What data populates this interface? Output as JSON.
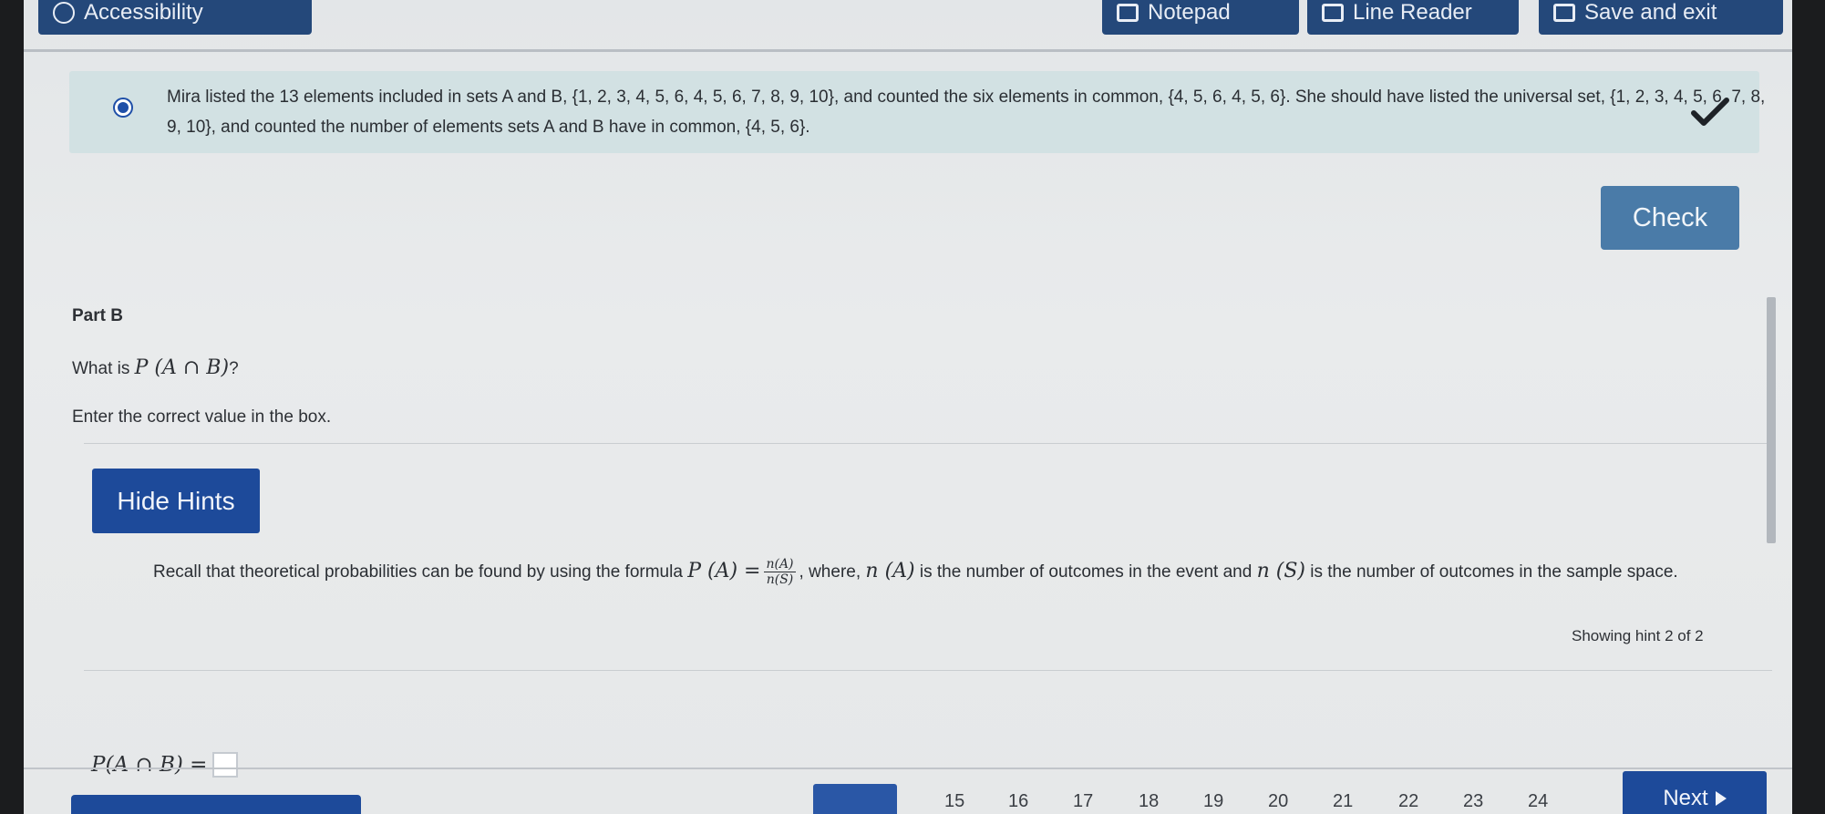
{
  "toolbar": {
    "accessibility_label": "Accessibility",
    "notepad_label": "Notepad",
    "line_reader_label": "Line Reader",
    "save_exit_label": "Save and exit"
  },
  "feedback": {
    "text": "Mira listed the 13 elements included in sets A and B, {1, 2, 3, 4, 5, 6, 4, 5, 6, 7, 8, 9, 10}, and counted the six elements in common, {4, 5, 6, 4, 5, 6}. She should have listed the universal set, {1, 2, 3, 4, 5, 6, 7, 8, 9, 10}, and counted the number of elements sets A and B have in common, {4, 5, 6}.",
    "correct": true
  },
  "check_button_label": "Check",
  "part": {
    "title": "Part B",
    "question_prefix": "What is ",
    "question_math": "P (A ∩ B)",
    "question_suffix": "?",
    "instructions": "Enter the correct value in the box."
  },
  "hints": {
    "toggle_label": "Hide Hints",
    "text_part1": "Recall that theoretical probabilities can be found by using the formula ",
    "formula_lhs": "P (A) =",
    "formula_num": "n(A)",
    "formula_den": "n(S)",
    "text_part2": ", where, ",
    "math_nA": "n (A)",
    "text_part3": " is the number of outcomes in the event and ",
    "math_nS": "n (S)",
    "text_part4": " is the number of outcomes in the sample space.",
    "status": "Showing hint 2 of 2"
  },
  "answer": {
    "label": "P(A ∩ B) =",
    "value": ""
  },
  "navigation": {
    "question_numbers": [
      "15",
      "16",
      "17",
      "18",
      "19",
      "20",
      "21",
      "22",
      "23",
      "24"
    ],
    "next_label": "Next"
  },
  "colors": {
    "primary": "#1d4a9a",
    "check_button": "#4a7ba8",
    "feedback_bg": "#d2e1e3"
  }
}
